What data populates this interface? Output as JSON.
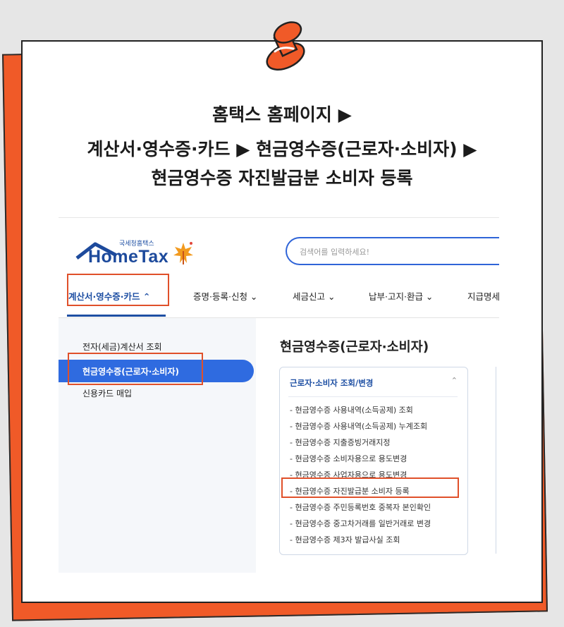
{
  "headline": {
    "line1": "홈택스 홈페이지 ▶",
    "line2": "계산서·영수증·카드 ▶ 현금영수증(근로자·소비자) ▶",
    "line3": "현금영수증 자진발급분 소비자 등록"
  },
  "hometax": {
    "logo_small": "국세청홈택스",
    "logo_big": "HomeTax",
    "search_placeholder": "검색어를 입력하세요!"
  },
  "nav": {
    "items": [
      {
        "label": "계산서·영수증·카드 ⌃"
      },
      {
        "label": "증명·등록·신청 ⌄"
      },
      {
        "label": "세금신고 ⌄"
      },
      {
        "label": "납부·고지·환급 ⌄"
      },
      {
        "label": "지급명세"
      }
    ]
  },
  "sidebar": {
    "items": [
      {
        "label": "전자(세금)계산서 조회"
      },
      {
        "label": "현금영수증(근로자·소비자)"
      },
      {
        "label": "신용카드 매입"
      }
    ]
  },
  "content": {
    "title": "현금영수증(근로자·소비자)",
    "card_header": "근로자·소비자 조회/변경",
    "card_items": [
      "- 현금영수증 사용내역(소득공제) 조회",
      "- 현금영수증 사용내역(소득공제) 누계조회",
      "- 현금영수증 지출증빙거래지정",
      "- 현금영수증 소비자용으로 용도변경",
      "- 현금영수증 사업자용으로 용도변경",
      "- 현금영수증 자진발급분 소비자 등록",
      "- 현금영수증 주민등록번호 중복자 본인확인",
      "- 현금영수증 중고차거래를 일반거래로 변경",
      "- 현금영수증 제3자 발급사실 조회"
    ]
  },
  "colors": {
    "accent_orange": "#f05a28",
    "highlight_box": "#e0502a",
    "hometax_blue": "#1e4fa3",
    "active_blue": "#2f6be0"
  }
}
